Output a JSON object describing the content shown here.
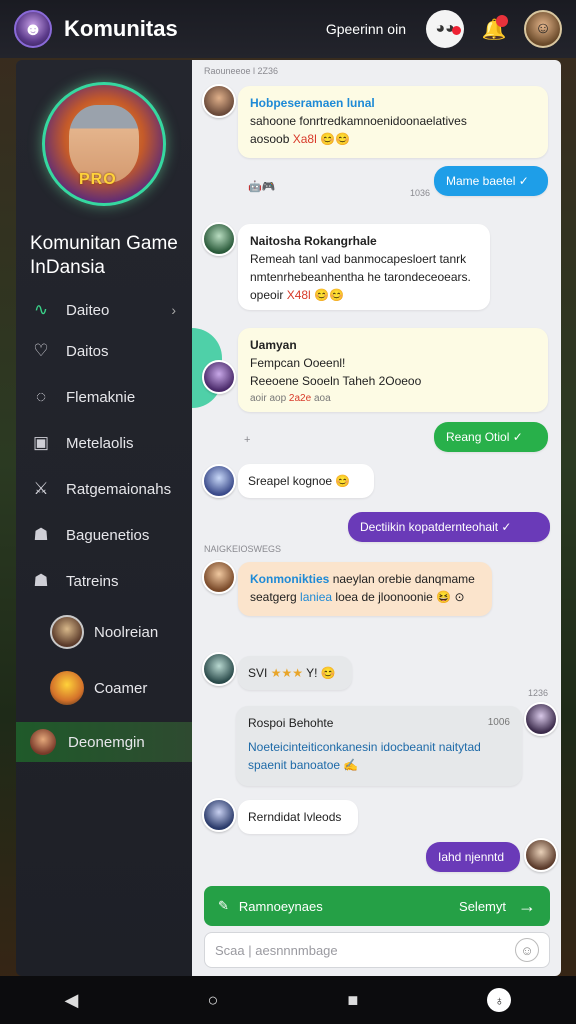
{
  "header": {
    "title": "Komunitas",
    "status": "Gpeerinn oin",
    "notification_count": "1"
  },
  "sidebar": {
    "hero_tag": "PRO",
    "community_name": "Komunitan Game InDansia",
    "items": [
      {
        "label": "Daiteo",
        "icon": "pulse-icon"
      },
      {
        "label": "Daitos",
        "icon": "heart-icon"
      },
      {
        "label": "Flemaknie",
        "icon": "chat-bubble-icon"
      },
      {
        "label": "Metelaolis",
        "icon": "gamepad-icon"
      },
      {
        "label": "Ratgemaionahs",
        "icon": "sword-icon"
      },
      {
        "label": "Baguenetios",
        "icon": "users-icon"
      },
      {
        "label": "Tatreins",
        "icon": "group-icon"
      },
      {
        "label": "Noolreian",
        "icon": "avatar"
      },
      {
        "label": "Coamer",
        "icon": "avatar"
      },
      {
        "label": "Deonemgin",
        "icon": "avatar"
      }
    ]
  },
  "chat": {
    "sys1": "Raouneeoe l 2Z36",
    "m1": {
      "name": "Hobpeseramaen lunal",
      "text": "sahoone fonrtredkamnoenidoonaelatives",
      "sub": "aosoob",
      "sub_red": "Xa8l",
      "emoji": "😊😊"
    },
    "reactions1": "🤖🎮",
    "time1": "1036",
    "out1": "Mame baetel ✓",
    "m2": {
      "name": "Naitosha Rokangrhale",
      "line1": "Remeah tanl vad banmocapesloert tanrk",
      "line2": "nmtenrhebeanhentha he tarondeceoears.",
      "sub": "opeoir",
      "sub_red": "X48l",
      "emoji": "😊😊"
    },
    "m3": {
      "name": "Uamyan",
      "line1": "Fempcan Ooeenl!",
      "line2": "Reeoene Sooeln",
      "line2b": "Taheh 2Ooeoo",
      "line3": "aoir aop",
      "line3_red": "2a2e",
      "line3b": "aoa"
    },
    "out2": "Reang Otiol ✓",
    "m4": {
      "text": "Sreapel kognoe",
      "emoji": "😊"
    },
    "out3": "Dectiikin kopatdernteohait ✓",
    "sys2": "NAIGKEIOSWEGS",
    "m5": {
      "name": "Konmonikties",
      "line1a": "naeylan orebie danqmame",
      "line2a": "seatgerg",
      "line2_blue": "laniea",
      "line2b": "loea",
      "line2c": "de jloonoonie 😆 ⊙"
    },
    "m6": {
      "prefix": "SVI",
      "stars": "★★★",
      "suffix": "Y!",
      "emoji": "😊"
    },
    "time2": "1236",
    "m7": {
      "name": "Rospoi Behohte",
      "time": "1006",
      "line1": "Noeteicinteiticonkanesin idocbeanit naitytad",
      "line2": "spaenit banoatoe ✍"
    },
    "m8": {
      "text": "Rerndidat Ivleods"
    },
    "out4": "Iahd njenntd",
    "input_send": {
      "left": "Ramnoeynaes",
      "right": "Selemyt"
    },
    "input_text": {
      "placeholder": "Scaa | aesnnnmbage"
    }
  },
  "colors": {
    "accent_green": "#28b04a",
    "accent_blue": "#1e9ee8",
    "accent_purple": "#6a3ab8",
    "sidebar_bg": "#24262e"
  }
}
